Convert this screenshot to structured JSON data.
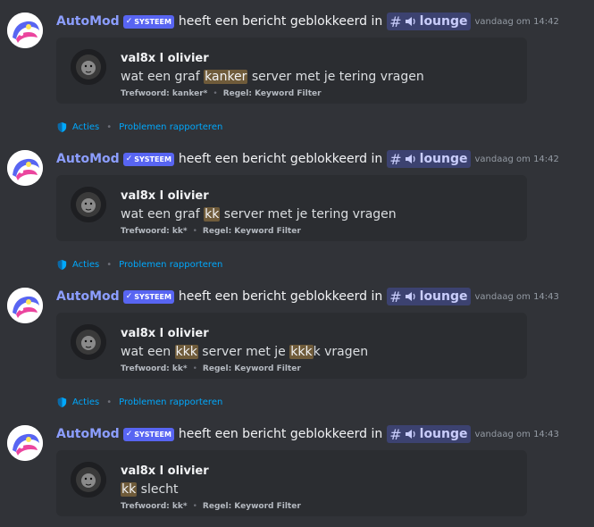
{
  "colors": {
    "background": "#313338",
    "card": "#2b2d31",
    "author": "#8c9eff",
    "badge": "#5865f2",
    "channel_bg": "#3c4270",
    "link": "#00a8fc",
    "highlight": "#6f5b3a"
  },
  "messages": [
    {
      "author": "AutoMod",
      "badge": "SYSTEEM",
      "action": "heeft een bericht geblokkeerd in",
      "channel": "lounge",
      "timestamp": "vandaag om 14:42",
      "blocked_user": "val8x l olivier",
      "content_before": "wat een graf ",
      "content_highlight": "kanker",
      "content_after": " server met je tering vragen",
      "keyword": "Trefwoord: kanker*",
      "rule": "Regel: Keyword Filter",
      "actions_label": "Acties",
      "report_label": "Problemen rapporteren"
    },
    {
      "author": "AutoMod",
      "badge": "SYSTEEM",
      "action": "heeft een bericht geblokkeerd in",
      "channel": "lounge",
      "timestamp": "vandaag om 14:42",
      "blocked_user": "val8x l olivier",
      "content_before": "wat een graf ",
      "content_highlight": "kk",
      "content_after": " server met je tering vragen",
      "keyword": "Trefwoord: kk*",
      "rule": "Regel: Keyword Filter",
      "actions_label": "Acties",
      "report_label": "Problemen rapporteren"
    },
    {
      "author": "AutoMod",
      "badge": "SYSTEEM",
      "action": "heeft een bericht geblokkeerd in",
      "channel": "lounge",
      "timestamp": "vandaag om 14:43",
      "blocked_user": "val8x l olivier",
      "content_before": "wat een ",
      "content_highlight": "kkk",
      "content_middle": " server met je ",
      "content_highlight2": "kkk",
      "content_after": "k vragen",
      "keyword": "Trefwoord: kk*",
      "rule": "Regel: Keyword Filter",
      "actions_label": "Acties",
      "report_label": "Problemen rapporteren"
    },
    {
      "author": "AutoMod",
      "badge": "SYSTEEM",
      "action": "heeft een bericht geblokkeerd in",
      "channel": "lounge",
      "timestamp": "vandaag om 14:43",
      "blocked_user": "val8x l olivier",
      "content_before": "",
      "content_highlight": "kk",
      "content_after": " slecht",
      "keyword": "Trefwoord: kk*",
      "rule": "Regel: Keyword Filter"
    }
  ]
}
